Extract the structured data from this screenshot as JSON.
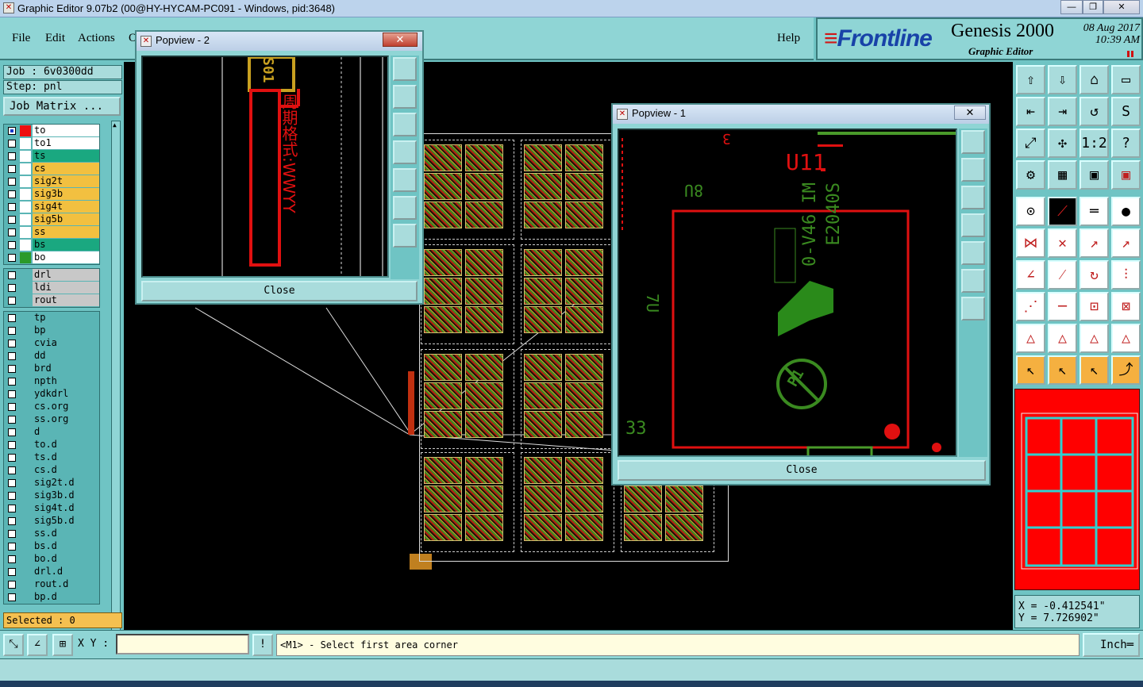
{
  "window": {
    "title": "Graphic Editor 9.07b2 (00@HY-HYCAM-PC091 - Windows, pid:3648)",
    "min_label": "—",
    "max_label": "❐",
    "close_label": "✕"
  },
  "menu": {
    "file": "File",
    "edit": "Edit",
    "actions": "Actions",
    "cut_label": "O",
    "help": "Help"
  },
  "brand": {
    "logo_text": "Frontline",
    "product": "Genesis 2000",
    "subtitle": "Graphic Editor",
    "date": "08 Aug 2017",
    "time": "10:39 AM"
  },
  "job": {
    "job_line": "Job : 6v0300dd",
    "step_line": "Step: pnl",
    "matrix_button": "Job Matrix ..."
  },
  "layers": {
    "group1": [
      {
        "name": "to",
        "color": "#ffffff",
        "swatch": "#ee1010",
        "checked": true
      },
      {
        "name": "to1",
        "color": "#ffffff",
        "swatch": "#ffffff"
      },
      {
        "name": "ts",
        "color": "#1aa880",
        "swatch": "#ffffff"
      },
      {
        "name": "cs",
        "color": "#f2c040",
        "swatch": "#ffffff"
      },
      {
        "name": "sig2t",
        "color": "#f2c040",
        "swatch": "#ffffff"
      },
      {
        "name": "sig3b",
        "color": "#f2c040",
        "swatch": "#ffffff"
      },
      {
        "name": "sig4t",
        "color": "#f2c040",
        "swatch": "#ffffff"
      },
      {
        "name": "sig5b",
        "color": "#f2c040",
        "swatch": "#ffffff"
      },
      {
        "name": "ss",
        "color": "#f2c040",
        "swatch": "#ffffff"
      },
      {
        "name": "bs",
        "color": "#1aa880",
        "swatch": "#ffffff"
      },
      {
        "name": "bo",
        "color": "#ffffff",
        "swatch": "#2a9a2a"
      }
    ],
    "group2": [
      {
        "name": "drl",
        "color": "#c8c8c8"
      },
      {
        "name": "ldi",
        "color": "#c8c8c8"
      },
      {
        "name": "rout",
        "color": "#c8c8c8"
      }
    ],
    "group3": [
      {
        "name": "tp"
      },
      {
        "name": "bp"
      },
      {
        "name": "cvia"
      },
      {
        "name": "dd"
      },
      {
        "name": "brd"
      },
      {
        "name": "npth"
      },
      {
        "name": "ydkdrl"
      },
      {
        "name": "cs.org"
      },
      {
        "name": "ss.org"
      },
      {
        "name": "d"
      },
      {
        "name": "to.d"
      },
      {
        "name": "ts.d"
      },
      {
        "name": "cs.d"
      },
      {
        "name": "sig2t.d"
      },
      {
        "name": "sig3b.d"
      },
      {
        "name": "sig4t.d"
      },
      {
        "name": "sig5b.d"
      },
      {
        "name": "ss.d"
      },
      {
        "name": "bs.d"
      },
      {
        "name": "bo.d"
      },
      {
        "name": "drl.d"
      },
      {
        "name": "rout.d"
      },
      {
        "name": "bp.d"
      }
    ]
  },
  "selected": "Selected : 0",
  "popview2": {
    "title": "Popview - 2",
    "close": "Close",
    "close_x": "✕",
    "silk_text": "周期格式:WWYY",
    "silk_code": "S01"
  },
  "popview1": {
    "title": "Popview - 1",
    "close": "Close",
    "close_x": "✕",
    "labels": {
      "u11": "U11",
      "three": "3",
      "eight": "8U",
      "code": "0-V46 IM",
      "part": "E2040S",
      "num33": "33",
      "l1": "7U",
      "p1": "P1"
    }
  },
  "coords": {
    "x": "X = -0.412541\"",
    "y": "Y = 7.726902\""
  },
  "bottom": {
    "xy_label": "X Y :",
    "xy_value": "",
    "bang": "!",
    "message": "<M1> - Select first area corner",
    "units": "Inch"
  },
  "icons": {
    "toolbar": [
      "home-icon",
      "snapshot-icon",
      "building-icon",
      "window-icon",
      "left-arrow-icon",
      "right-arrow-icon",
      "zoom-icon",
      "s-curve-icon",
      "fit-icon",
      "center-icon",
      "scale-icon",
      "help-icon",
      "tools-icon",
      "grid-icon",
      "layers-icon",
      "layers-red-icon",
      "circle-point-icon",
      "slope-icon",
      "ruler-icon",
      "dot-icon",
      "join-icon",
      "cross-icon",
      "line-icon",
      "line2-icon",
      "angle-icon",
      "diag-icon",
      "rotate-icon",
      "split-icon",
      "vector-icon",
      "minus-icon",
      "resize-icon",
      "group-icon",
      "triangle-icon",
      "triangle2-icon",
      "triangle3-icon",
      "triangle4-icon",
      "pointer-icon",
      "pointer2-icon",
      "pointer3-icon",
      "pointer4-icon"
    ]
  }
}
